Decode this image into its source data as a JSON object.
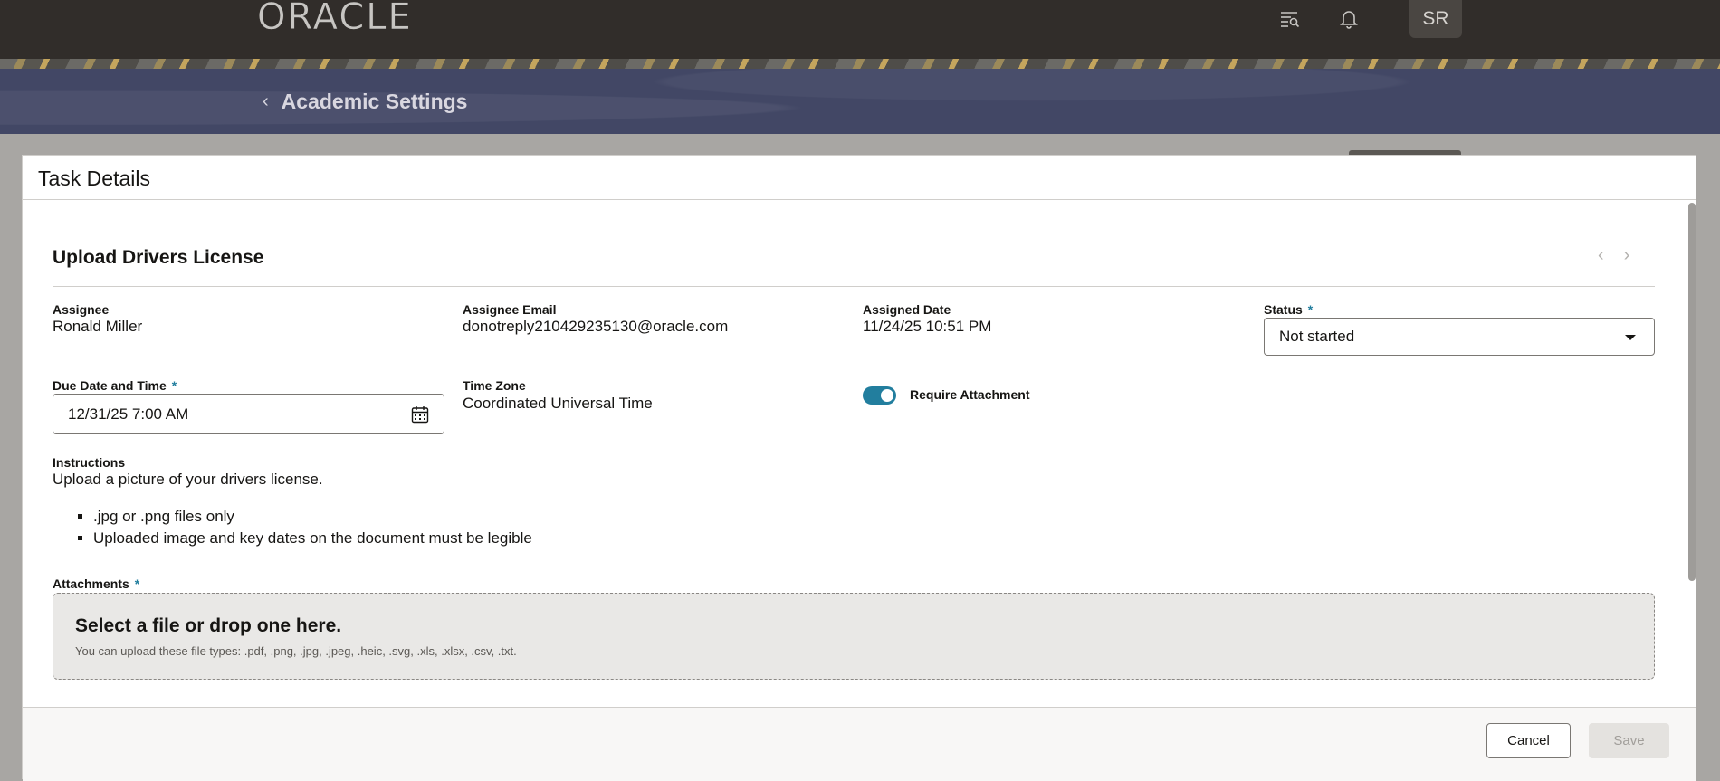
{
  "header": {
    "logo_text": "ORACLE",
    "avatar_initials": "SR",
    "icons": [
      "search-list-icon",
      "bell-icon"
    ]
  },
  "page": {
    "back_title": "Academic Settings"
  },
  "dialog": {
    "title": "Task Details",
    "task_title": "Upload Drivers License",
    "assignee_label": "Assignee",
    "assignee_value": "Ronald Miller",
    "email_label": "Assignee Email",
    "email_value": "donotreply210429235130@oracle.com",
    "assigned_date_label": "Assigned Date",
    "assigned_date_value": "11/24/25 10:51 PM",
    "status_label": "Status",
    "status_value": "Not started",
    "due_label": "Due Date and Time",
    "due_value": "12/31/25 7:00 AM",
    "timezone_label": "Time Zone",
    "timezone_value": "Coordinated Universal Time",
    "require_attachment_label": "Require Attachment",
    "require_attachment_on": true,
    "instructions_label": "Instructions",
    "instructions_text": "Upload a picture of your drivers license.",
    "instruction_bullets": [
      ".jpg or .png files only",
      "Uploaded image and key dates on the document must be legible"
    ],
    "attachments_label": "Attachments",
    "dropzone_title": "Select a file or drop one here.",
    "dropzone_sub": "You can upload these file types: .pdf, .png, .jpg, .jpeg, .heic, .svg, .xls, .xlsx, .csv, .txt.",
    "required_marker": "*"
  },
  "footer": {
    "cancel_label": "Cancel",
    "save_label": "Save"
  },
  "colors": {
    "accent": "#227e9e",
    "header_bg": "#312d2a",
    "banner_bg": "#424765"
  }
}
